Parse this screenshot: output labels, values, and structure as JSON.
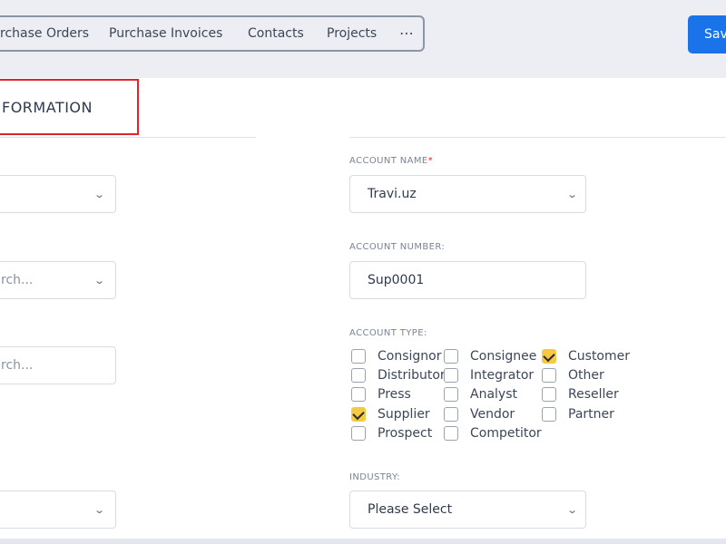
{
  "tabs": {
    "purchase_orders": "rchase Orders",
    "purchase_invoices": "Purchase Invoices",
    "contacts": "Contacts",
    "projects": "Projects",
    "more": "⋯"
  },
  "header": {
    "save_label": "Sav"
  },
  "section": {
    "title": "FORMATION"
  },
  "left_fields": {
    "search_1_placeholder": "rch...",
    "search_2_placeholder": "rch..."
  },
  "account_name": {
    "label": "ACCOUNT NAME",
    "required_mark": "*",
    "value": "Travi.uz"
  },
  "account_number": {
    "label": "ACCOUNT NUMBER:",
    "value": "Sup0001"
  },
  "account_type": {
    "label": "ACCOUNT TYPE:",
    "options": [
      {
        "label": "Consignor",
        "checked": false
      },
      {
        "label": "Consignee",
        "checked": false
      },
      {
        "label": "Customer",
        "checked": true
      },
      {
        "label": "Distributor",
        "checked": false
      },
      {
        "label": "Integrator",
        "checked": false
      },
      {
        "label": "Other",
        "checked": false
      },
      {
        "label": "Press",
        "checked": false
      },
      {
        "label": "Analyst",
        "checked": false
      },
      {
        "label": "Reseller",
        "checked": false
      },
      {
        "label": "Supplier",
        "checked": true
      },
      {
        "label": "Vendor",
        "checked": false
      },
      {
        "label": "Partner",
        "checked": false
      },
      {
        "label": "Prospect",
        "checked": false
      },
      {
        "label": "Competitor",
        "checked": false
      }
    ]
  },
  "industry": {
    "label": "INDUSTRY:",
    "value": "Please Select"
  },
  "icons": {
    "chevron": "chevron-down-icon",
    "checkmark": "checkmark-icon"
  },
  "colors": {
    "accent": "#1a73e8",
    "checked": "#f6c943",
    "highlight": "#e0262c"
  }
}
